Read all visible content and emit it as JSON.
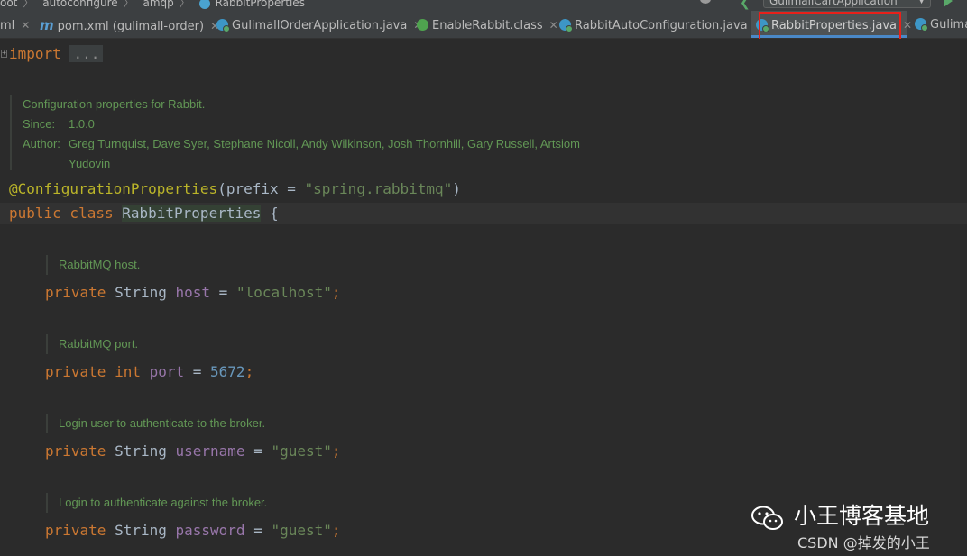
{
  "breadcrumb": [
    "oot",
    "autoconfigure",
    "amqp",
    "RabbitProperties"
  ],
  "run_config": "GulimallCartApplication",
  "tabs": [
    {
      "label": "ml",
      "icon": "file-icon"
    },
    {
      "label": "pom.xml (gulimall-order)",
      "icon": "maven-icon"
    },
    {
      "label": "GulimallOrderApplication.java",
      "icon": "class-icon"
    },
    {
      "label": "EnableRabbit.class",
      "icon": "annotation-icon"
    },
    {
      "label": "RabbitAutoConfiguration.java",
      "icon": "class-icon"
    },
    {
      "label": "RabbitProperties.java",
      "icon": "class-icon",
      "active": true
    },
    {
      "label": "Gulima",
      "icon": "class-icon"
    }
  ],
  "code": {
    "import_kw": "import",
    "import_folded": "...",
    "doc_class": {
      "text": "Configuration properties for Rabbit.",
      "since_label": "Since:",
      "since_value": "1.0.0",
      "author_label": "Author:",
      "author_line1": "Greg Turnquist, Dave Syer, Stephane Nicoll, Andy Wilkinson, Josh Thornhill, Gary Russell, Artsiom",
      "author_line2": "Yudovin"
    },
    "annotation": "@ConfigurationProperties",
    "annotation_open": "(prefix = ",
    "annotation_value": "\"spring.rabbitmq\"",
    "annotation_close": ")",
    "class_kw": "public class ",
    "class_name": "RabbitProperties",
    "class_brace": " {",
    "fields": [
      {
        "doc": "RabbitMQ host.",
        "modifier": "private ",
        "type": "String ",
        "name": "host",
        "assign": " = ",
        "value": "\"localhost\"",
        "value_kind": "str"
      },
      {
        "doc": "RabbitMQ port.",
        "modifier": "private ",
        "type": "int ",
        "name": "port",
        "assign": " = ",
        "value": "5672",
        "value_kind": "num"
      },
      {
        "doc": "Login user to authenticate to the broker.",
        "modifier": "private ",
        "type": "String ",
        "name": "username",
        "assign": " = ",
        "value": "\"guest\"",
        "value_kind": "str"
      },
      {
        "doc": "Login to authenticate against the broker.",
        "modifier": "private ",
        "type": "String ",
        "name": "password",
        "assign": " = ",
        "value": "\"guest\"",
        "value_kind": "str"
      }
    ],
    "semicolon": ";"
  },
  "watermark": {
    "title": "小王博客基地",
    "subtitle": "CSDN @掉发的小王"
  },
  "colors": {
    "keyword": "#cc7832",
    "string": "#6a8759",
    "field": "#9876aa",
    "number": "#6897bb",
    "annotation": "#bbb529",
    "doc": "#629755",
    "highlight_box": "#e8201a"
  }
}
